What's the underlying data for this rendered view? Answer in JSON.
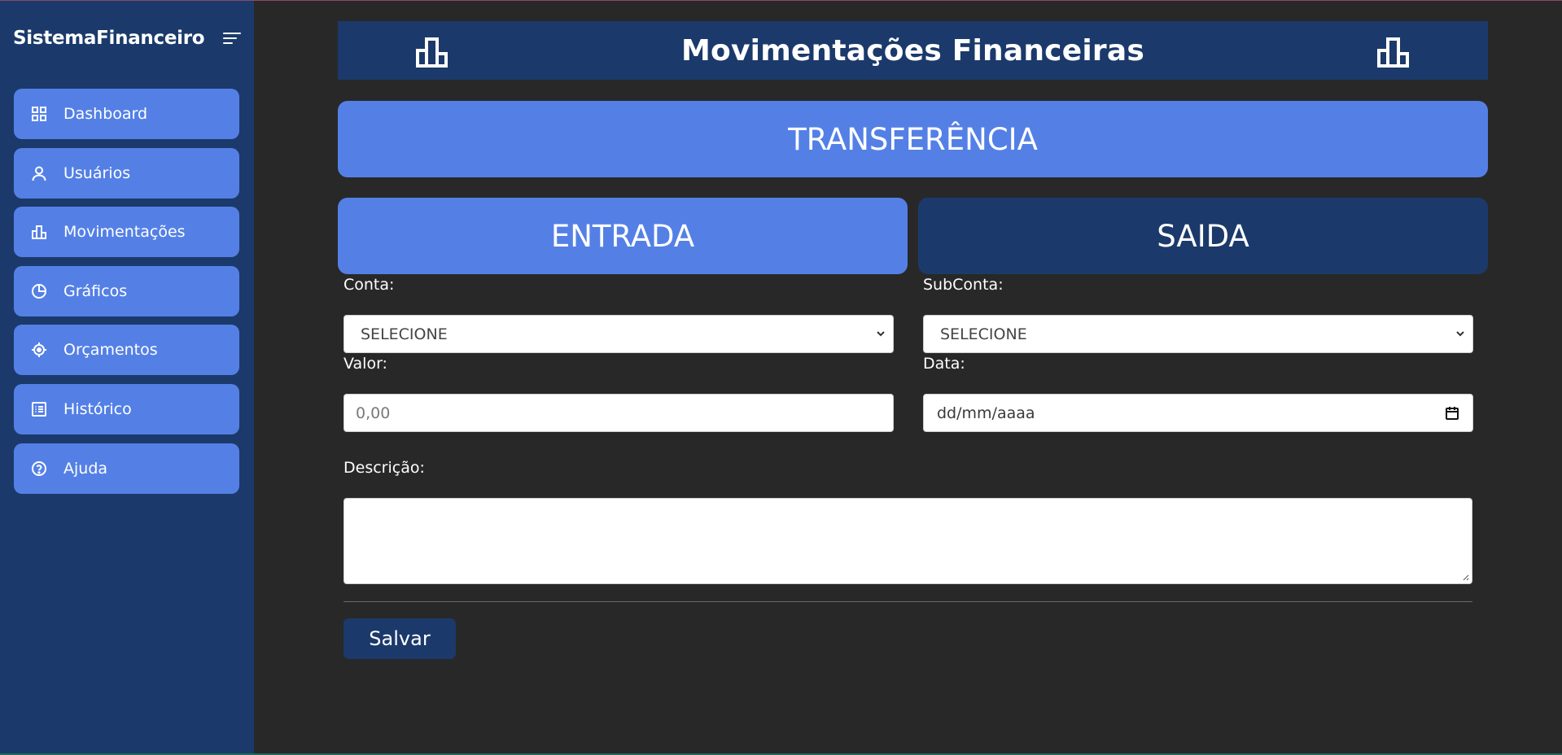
{
  "sidebar": {
    "brand": "SistemaFinanceiro",
    "items": [
      {
        "label": "Dashboard",
        "icon": "dashboard-grid-icon"
      },
      {
        "label": "Usuários",
        "icon": "user-icon"
      },
      {
        "label": "Movimentações",
        "icon": "bar-chart-icon"
      },
      {
        "label": "Gráficos",
        "icon": "pie-chart-icon"
      },
      {
        "label": "Orçamentos",
        "icon": "target-icon"
      },
      {
        "label": "Histórico",
        "icon": "list-icon"
      },
      {
        "label": "Ajuda",
        "icon": "help-icon"
      }
    ]
  },
  "header": {
    "title": "Movimentações Financeiras"
  },
  "type_buttons": {
    "transfer": "TRANSFERÊNCIA",
    "entrada": "ENTRADA",
    "saida": "SAIDA"
  },
  "form": {
    "conta_label": "Conta:",
    "conta_value": "SELECIONE",
    "subconta_label": "SubConta:",
    "subconta_value": "SELECIONE",
    "valor_label": "Valor:",
    "valor_placeholder": "0,00",
    "data_label": "Data:",
    "data_placeholder": "dd/mm/aaaa",
    "descricao_label": "Descrição:",
    "save_label": "Salvar"
  },
  "colors": {
    "sidebar_bg": "#1b3a6b",
    "accent": "#5480e6",
    "page_bg": "#282828"
  }
}
